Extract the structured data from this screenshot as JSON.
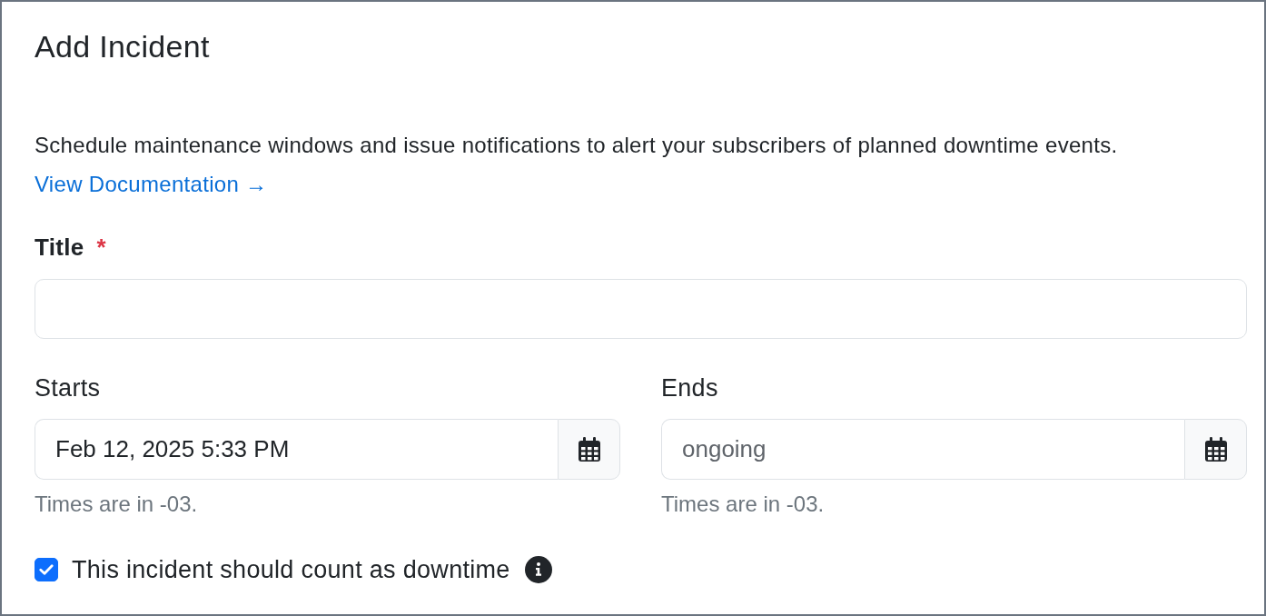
{
  "heading": "Add Incident",
  "description": {
    "text": "Schedule maintenance windows and issue notifications to alert your subscribers of planned downtime events.",
    "link": "View Documentation →"
  },
  "title_field": {
    "label": "Title",
    "required_mark": "*"
  },
  "schedule": [
    {
      "label": "Starts",
      "value": "Feb 12, 2025 5:33 PM",
      "help": "Times are in -03."
    },
    {
      "label": "Ends",
      "placeholder": "ongoing",
      "help": "Times are in -03."
    }
  ],
  "downtime": {
    "label": "This incident should count as downtime",
    "checked": true
  }
}
